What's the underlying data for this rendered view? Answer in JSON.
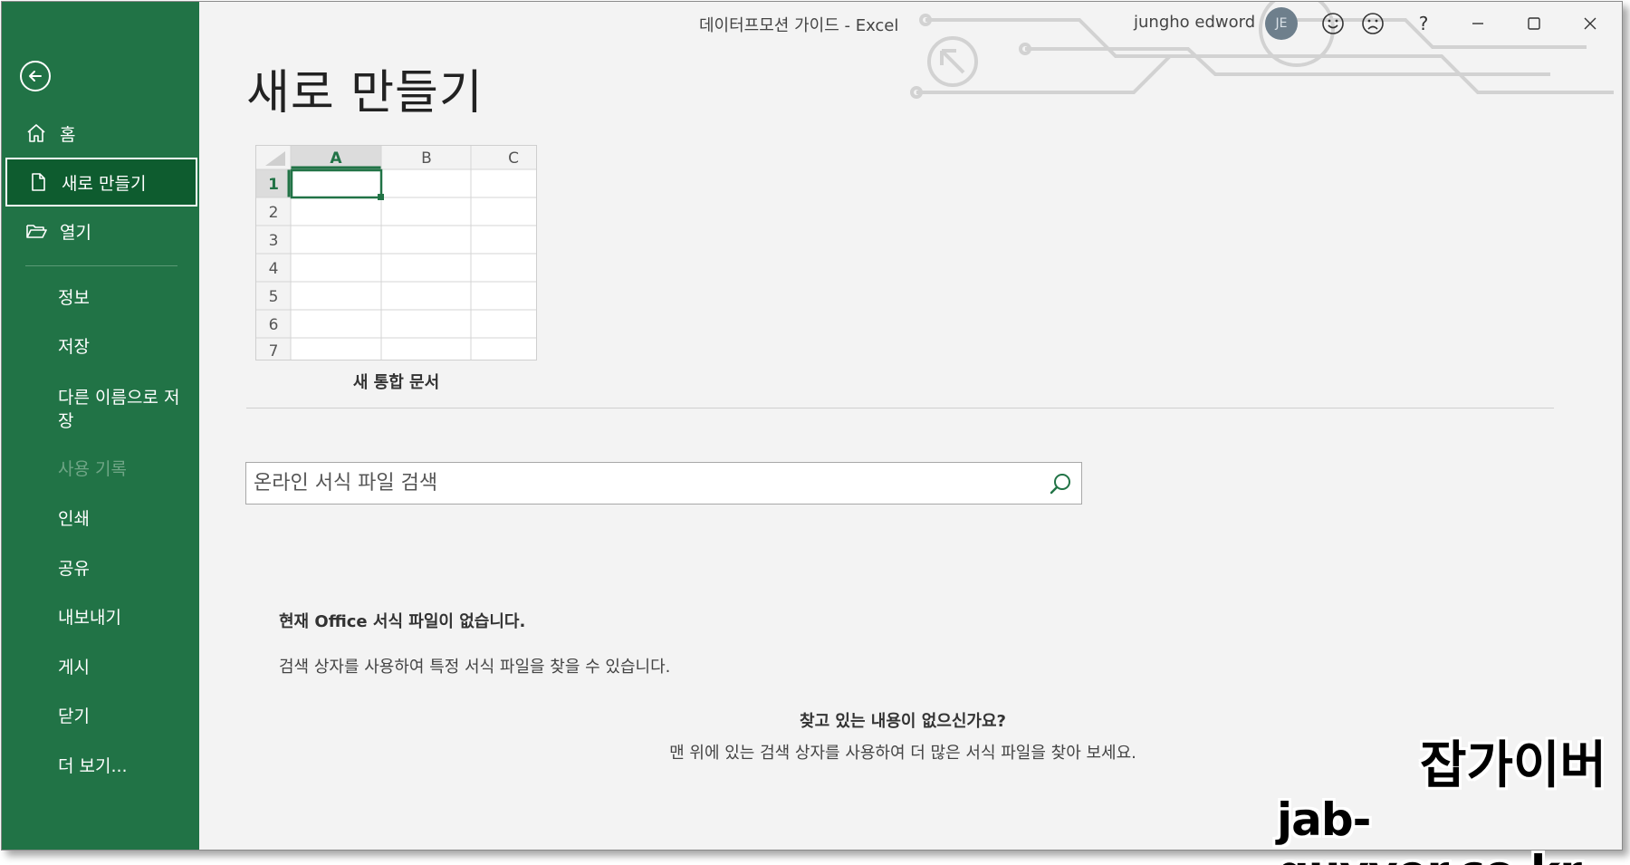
{
  "titlebar": {
    "title": "데이터프모션 가이드  -  Excel",
    "user_name": "jungho edword",
    "avatar_initials": "JE",
    "help_label": "?"
  },
  "sidebar": {
    "items": [
      {
        "label": "홈",
        "icon": "home-icon"
      },
      {
        "label": "새로 만들기",
        "icon": "new-document-icon",
        "active": true
      },
      {
        "label": "열기",
        "icon": "folder-open-icon"
      }
    ],
    "subitems": [
      {
        "label": "정보"
      },
      {
        "label": "저장"
      },
      {
        "label": "다른 이름으로 저장"
      },
      {
        "label": "사용 기록",
        "disabled": true
      },
      {
        "label": "인쇄"
      },
      {
        "label": "공유"
      },
      {
        "label": "내보내기"
      },
      {
        "label": "게시"
      },
      {
        "label": "닫기"
      },
      {
        "label": "더 보기..."
      }
    ]
  },
  "main": {
    "page_title": "새로 만들기",
    "template": {
      "label": "새 통합 문서",
      "columns": [
        "A",
        "B",
        "C"
      ],
      "rows": [
        "1",
        "2",
        "3",
        "4",
        "5",
        "6",
        "7"
      ]
    },
    "search": {
      "placeholder": "온라인 서식 파일 검색"
    },
    "empty_title": "현재 Office 서식 파일이 없습니다.",
    "empty_text": "검색 상자를 사용하여 특정 서식 파일을 찾을 수 있습니다.",
    "hint_title": "찾고 있는 내용이 없으신가요?",
    "hint_text": "맨 위에 있는 검색 상자를 사용하여 더 많은 서식 파일을 찾아 보세요."
  },
  "watermark": {
    "name": "잡가이버",
    "url": "jab-guyver.co.kr"
  },
  "colors": {
    "accent": "#217346",
    "accent_dark": "#0e5c2f"
  }
}
